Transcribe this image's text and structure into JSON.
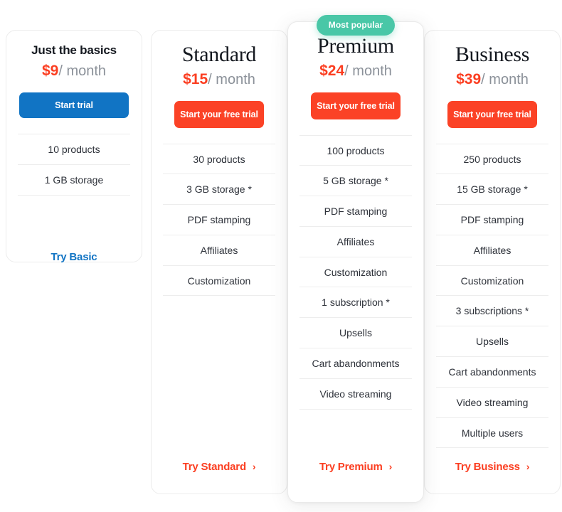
{
  "badge": {
    "text": "Most popular"
  },
  "plans": [
    {
      "name": "Just the basics",
      "price": "$9",
      "period": "/ month",
      "button": "Start trial",
      "features": [
        "10 products",
        "1 GB storage"
      ],
      "cta": "Try Basic",
      "chevron": ""
    },
    {
      "name": "Standard",
      "price": "$15",
      "period": "/ month",
      "button": "Start your free trial",
      "features": [
        "30 products",
        "3 GB storage *",
        "PDF stamping",
        "Affiliates",
        "Customization"
      ],
      "cta": "Try Standard",
      "chevron": "›"
    },
    {
      "name": "Premium",
      "price": "$24",
      "period": "/ month",
      "button": "Start your free trial",
      "features": [
        "100 products",
        "5 GB storage *",
        "PDF stamping",
        "Affiliates",
        "Customization",
        "1 subscription *",
        "Upsells",
        "Cart abandonments",
        "Video streaming"
      ],
      "cta": "Try Premium",
      "chevron": "›"
    },
    {
      "name": "Business",
      "price": "$39",
      "period": "/ month",
      "button": "Start your free trial",
      "features": [
        "250 products",
        "15 GB storage *",
        "PDF stamping",
        "Affiliates",
        "Customization",
        "3 subscriptions *",
        "Upsells",
        "Cart abandonments",
        "Video streaming",
        "Multiple users"
      ],
      "cta": "Try Business",
      "chevron": "›"
    }
  ],
  "colors": {
    "accent_red": "#fb4226",
    "accent_blue": "#1174c4",
    "badge_teal": "#49c7a7",
    "text_dark": "#14181f",
    "text_muted": "#8b9199",
    "divider": "#ededed"
  }
}
